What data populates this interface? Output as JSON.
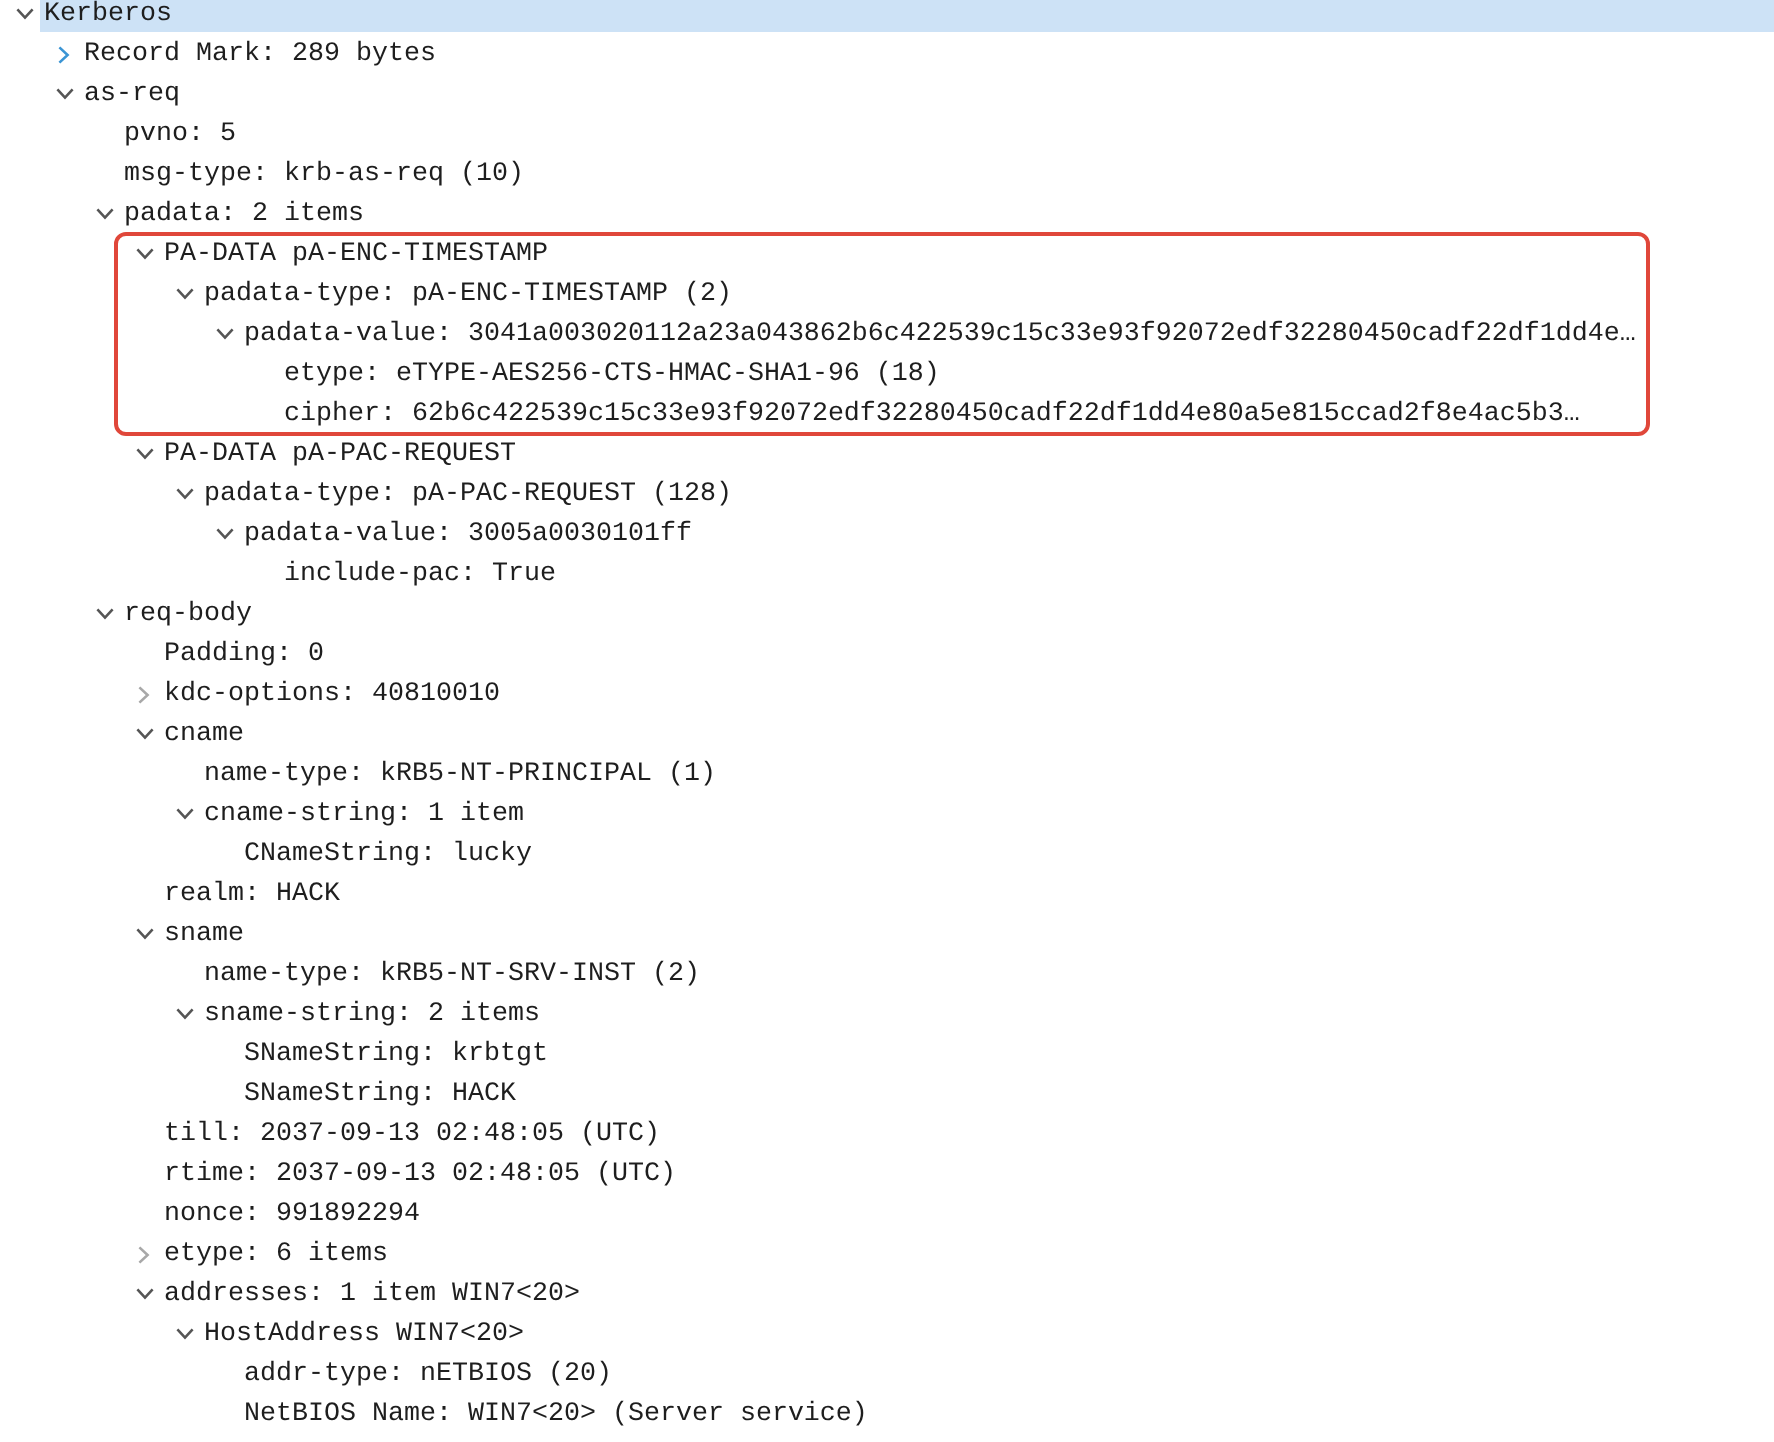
{
  "tree": [
    {
      "label": "Kerberos",
      "expanded": true,
      "hovered": false,
      "selected": true,
      "children": [
        {
          "label": "Record Mark: 289 bytes",
          "expanded": false,
          "hovered": true,
          "selected": false
        },
        {
          "label": "as-req",
          "expanded": true,
          "hovered": false,
          "selected": false,
          "children": [
            {
              "label": "pvno: 5",
              "selected": false
            },
            {
              "label": "msg-type: krb-as-req (10)",
              "selected": false
            },
            {
              "label": "padata: 2 items",
              "expanded": true,
              "hovered": false,
              "selected": false,
              "children": [
                {
                  "label": "PA-DATA pA-ENC-TIMESTAMP",
                  "expanded": true,
                  "hovered": false,
                  "selected": false,
                  "highlighted": true,
                  "children": [
                    {
                      "label": "padata-type: pA-ENC-TIMESTAMP (2)",
                      "expanded": true,
                      "hovered": false,
                      "selected": false,
                      "children": [
                        {
                          "label": "padata-value: 3041a003020112a23a043862b6c422539c15c33e93f92072edf32280450cadf22df1dd4e…",
                          "expanded": true,
                          "hovered": false,
                          "selected": false,
                          "children": [
                            {
                              "label": "etype: eTYPE-AES256-CTS-HMAC-SHA1-96 (18)",
                              "selected": false
                            },
                            {
                              "label": "cipher: 62b6c422539c15c33e93f92072edf32280450cadf22df1dd4e80a5e815ccad2f8e4ac5b3…",
                              "selected": false
                            }
                          ]
                        }
                      ]
                    }
                  ]
                },
                {
                  "label": "PA-DATA pA-PAC-REQUEST",
                  "expanded": true,
                  "hovered": false,
                  "selected": false,
                  "children": [
                    {
                      "label": "padata-type: pA-PAC-REQUEST (128)",
                      "expanded": true,
                      "hovered": false,
                      "selected": false,
                      "children": [
                        {
                          "label": "padata-value: 3005a0030101ff",
                          "expanded": true,
                          "hovered": false,
                          "selected": false,
                          "children": [
                            {
                              "label": "include-pac: True",
                              "selected": false
                            }
                          ]
                        }
                      ]
                    }
                  ]
                }
              ]
            },
            {
              "label": "req-body",
              "expanded": true,
              "hovered": false,
              "selected": false,
              "children": [
                {
                  "label": "Padding: 0",
                  "selected": false
                },
                {
                  "label": "kdc-options: 40810010",
                  "expanded": false,
                  "hovered": false,
                  "selected": false
                },
                {
                  "label": "cname",
                  "expanded": true,
                  "hovered": false,
                  "selected": false,
                  "children": [
                    {
                      "label": "name-type: kRB5-NT-PRINCIPAL (1)",
                      "selected": false
                    },
                    {
                      "label": "cname-string: 1 item",
                      "expanded": true,
                      "hovered": false,
                      "selected": false,
                      "children": [
                        {
                          "label": "CNameString: lucky",
                          "selected": false
                        }
                      ]
                    }
                  ]
                },
                {
                  "label": "realm: HACK",
                  "selected": false
                },
                {
                  "label": "sname",
                  "expanded": true,
                  "hovered": false,
                  "selected": false,
                  "children": [
                    {
                      "label": "name-type: kRB5-NT-SRV-INST (2)",
                      "selected": false
                    },
                    {
                      "label": "sname-string: 2 items",
                      "expanded": true,
                      "hovered": false,
                      "selected": false,
                      "children": [
                        {
                          "label": "SNameString: krbtgt",
                          "selected": false
                        },
                        {
                          "label": "SNameString: HACK",
                          "selected": false
                        }
                      ]
                    }
                  ]
                },
                {
                  "label": "till: 2037-09-13 02:48:05 (UTC)",
                  "selected": false
                },
                {
                  "label": "rtime: 2037-09-13 02:48:05 (UTC)",
                  "selected": false
                },
                {
                  "label": "nonce: 991892294",
                  "selected": false
                },
                {
                  "label": "etype: 6 items",
                  "expanded": false,
                  "hovered": false,
                  "selected": false
                },
                {
                  "label": "addresses: 1 item WIN7<20>",
                  "expanded": true,
                  "hovered": false,
                  "selected": false,
                  "children": [
                    {
                      "label": "HostAddress WIN7<20>",
                      "expanded": true,
                      "hovered": false,
                      "selected": false,
                      "children": [
                        {
                          "label": "addr-type: nETBIOS (20)",
                          "selected": false
                        },
                        {
                          "label": "NetBIOS Name: WIN7<20> (Server service)",
                          "selected": false
                        }
                      ]
                    }
                  ]
                }
              ]
            }
          ]
        }
      ]
    }
  ]
}
